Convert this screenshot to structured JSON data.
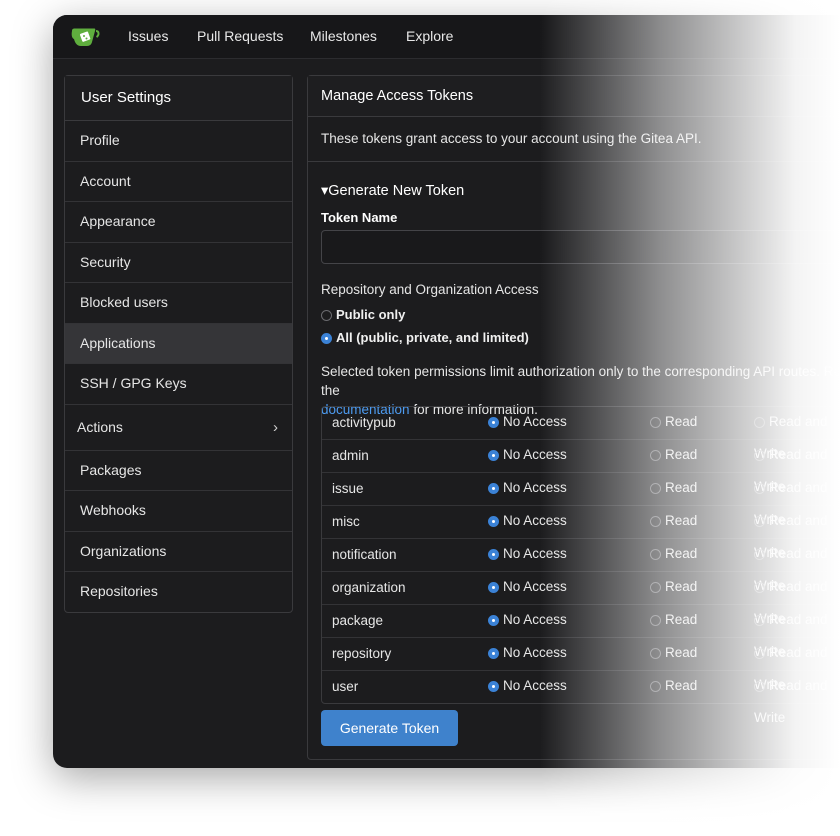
{
  "nav": {
    "items": [
      "Issues",
      "Pull Requests",
      "Milestones",
      "Explore"
    ]
  },
  "sidebar": {
    "title": "User Settings",
    "items": [
      {
        "label": "Profile"
      },
      {
        "label": "Account"
      },
      {
        "label": "Appearance"
      },
      {
        "label": "Security"
      },
      {
        "label": "Blocked users"
      },
      {
        "label": "Applications"
      },
      {
        "label": "SSH / GPG Keys"
      },
      {
        "label": "Actions"
      },
      {
        "label": "Packages"
      },
      {
        "label": "Webhooks"
      },
      {
        "label": "Organizations"
      },
      {
        "label": "Repositories"
      }
    ]
  },
  "panel": {
    "title": "Manage Access Tokens",
    "description": "These tokens grant access to your account using the Gitea API.",
    "generate_heading": "▾Generate New Token",
    "token_name_label": "Token Name",
    "token_name_value": "",
    "repo_access_label": "Repository and Organization Access",
    "radio_public": "Public only",
    "radio_all": "All (public, private, and limited)",
    "perm_info_prefix": "Selected token permissions limit authorization only to the corresponding API routes. Read the",
    "perm_info_link": "documentation",
    "perm_info_suffix": "for more information.",
    "permissions": [
      {
        "name": "activitypub"
      },
      {
        "name": "admin"
      },
      {
        "name": "issue"
      },
      {
        "name": "misc"
      },
      {
        "name": "notification"
      },
      {
        "name": "organization"
      },
      {
        "name": "package"
      },
      {
        "name": "repository"
      },
      {
        "name": "user"
      }
    ],
    "options": {
      "no_access": "No Access",
      "read": "Read",
      "read_write": "Read and Write"
    },
    "generate_button": "Generate Token"
  },
  "colors": {
    "accent": "#3f82cc",
    "link": "#4d9bf0",
    "background": "#1c1c1e",
    "logo": "#5fae3e"
  },
  "icons": [
    "gitea-logo-icon",
    "chevron-right-icon",
    "caret-down-icon"
  ]
}
